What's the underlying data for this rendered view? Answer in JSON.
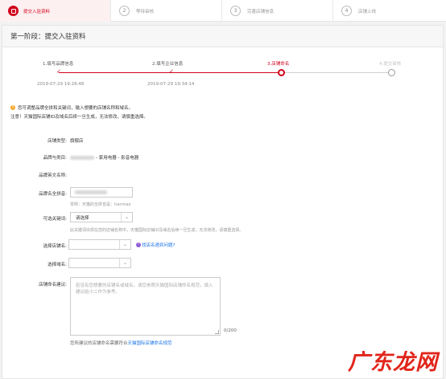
{
  "topbar": {
    "steps": [
      {
        "num": "",
        "label": "提交入驻资料",
        "active": true
      },
      {
        "num": "2",
        "label": "等待审核"
      },
      {
        "num": "3",
        "label": "完善店铺信息"
      },
      {
        "num": "4",
        "label": "店铺上线"
      }
    ]
  },
  "panel": {
    "title": "第一阶段：提交入驻资料"
  },
  "progress": {
    "steps": [
      {
        "label": "1.填写品牌信息",
        "time": "2019-07-29 19:28:48",
        "state": "done"
      },
      {
        "label": "2.填写企业信息",
        "time": "2019-07-29 19:34:14",
        "state": "done"
      },
      {
        "label": "3.店铺命名",
        "state": "current"
      },
      {
        "label": "4.提交审核",
        "state": "todo"
      }
    ]
  },
  "notice": {
    "line1": "您可调整品牌全拼和关键词，输入想要的店铺名称和域名。",
    "line2": "注意！天猫国际店铺ID及域名后续一旦生成，无法修改，请慎重选择。"
  },
  "form": {
    "shop_type_label": "店铺类型:",
    "shop_type_value": "旗舰店",
    "brand_category_label": "品牌与类目:",
    "brand_category_value": "- 家用电器 - 影音电器",
    "brand_en_label": "品牌英文名称:",
    "brand_pinyin_label": "品牌名全拼音:",
    "brand_pinyin_hint": "举例：天猫的全拼音是：tianmao",
    "keyword_label": "可选关键词:",
    "keyword_value": "请选择",
    "keyword_hint": "此关键词出现在您的店铺名称中，天猫国际店铺ID及域名后续一旦生成，无法修改，请慎重选择。",
    "shop_name_label": "选择店铺名:",
    "shop_name_value": "",
    "shop_name_link": "找店名遇到问题?",
    "domain_label": "选择域名:",
    "domain_value": "",
    "suggest_label": "店铺命名建议:",
    "suggest_placeholder": "若没有您想要的店铺名或域名，请您参照天猫国际店铺命名规范，填入建议给小二作为参考。",
    "counter": "0/200",
    "bottom_note_prefix": "您所建议的店铺命名需要符合",
    "bottom_note_link": "天猫国际店铺命名规范"
  },
  "watermark": {
    "text": "广东龙网"
  },
  "colors": {
    "accent": "#d0021b",
    "link": "#1a73e8",
    "warn": "#f5a623"
  }
}
